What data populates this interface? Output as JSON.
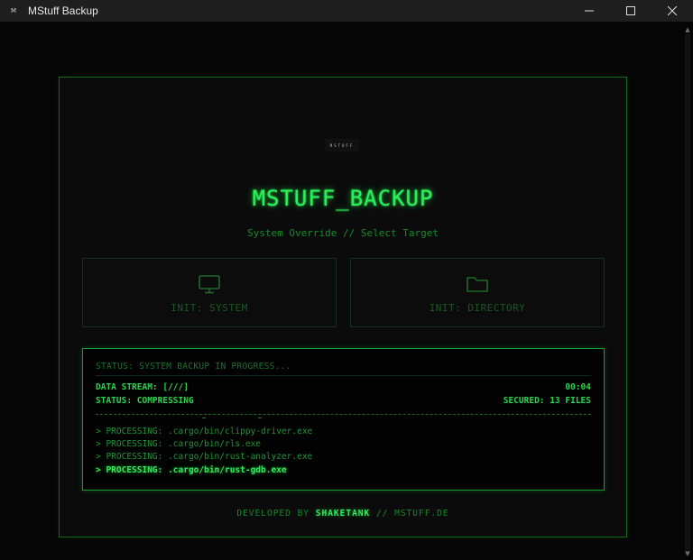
{
  "window": {
    "title": "MStuff Backup",
    "icon_text": "M",
    "controls": [
      "minimize-icon",
      "maximize-icon",
      "close-icon"
    ]
  },
  "app": {
    "logo_text": "MSTUFF",
    "title": "MSTUFF_BACKUP",
    "subtitle": "System Override // Select Target",
    "buttons": [
      {
        "label": "INIT: SYSTEM",
        "icon": "monitor-icon"
      },
      {
        "label": "INIT: DIRECTORY",
        "icon": "folder-icon"
      }
    ]
  },
  "status": {
    "header": "STATUS: SYSTEM BACKUP IN PROGRESS...",
    "data_stream": "DATA STREAM: [///]",
    "elapsed": "00:04",
    "state": "STATUS: COMPRESSING",
    "secured": "SECURED: 13 FILES",
    "log": [
      "> PROCESSING: .cargo/bin/clippy-driver.exe",
      "> PROCESSING: .cargo/bin/rls.exe",
      "> PROCESSING: .cargo/bin/rust-analyzer.exe",
      "> PROCESSING: .cargo/bin/rust-gdb.exe"
    ]
  },
  "footer": {
    "prefix": "DEVELOPED BY ",
    "brand": "SHAKETANK",
    "suffix": " // MSTUFF.DE"
  },
  "colors": {
    "accent": "#2cf05a",
    "dim_green": "#0e8f2a",
    "border_green": "#0f6d18",
    "background": "#050505"
  }
}
